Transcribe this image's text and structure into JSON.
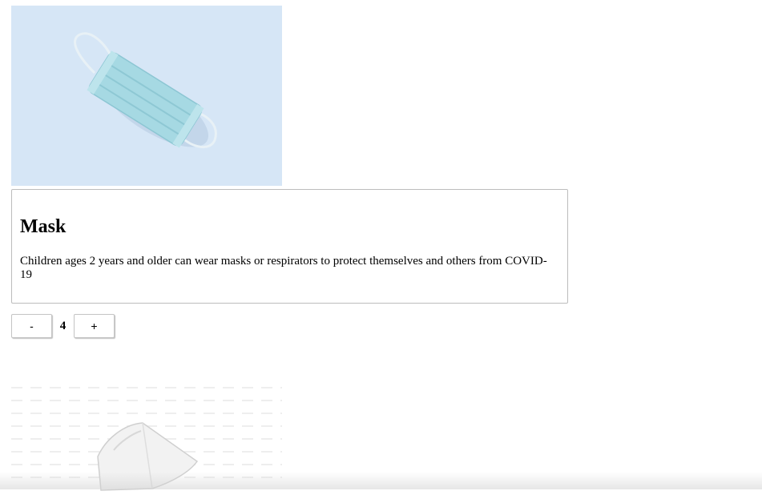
{
  "products": [
    {
      "image_icon": "surgical-mask-image",
      "title": "Mask",
      "description": "Children ages 2 years and older can wear masks or respirators to protect themselves and others from COVID-19",
      "quantity": "4",
      "decrement_label": "-",
      "increment_label": "+"
    },
    {
      "image_icon": "respirator-mask-image"
    }
  ],
  "colors": {
    "mask_background": "#d6e6f6",
    "mask_fabric": "#a9dbe4",
    "border": "#bdbdbd"
  }
}
